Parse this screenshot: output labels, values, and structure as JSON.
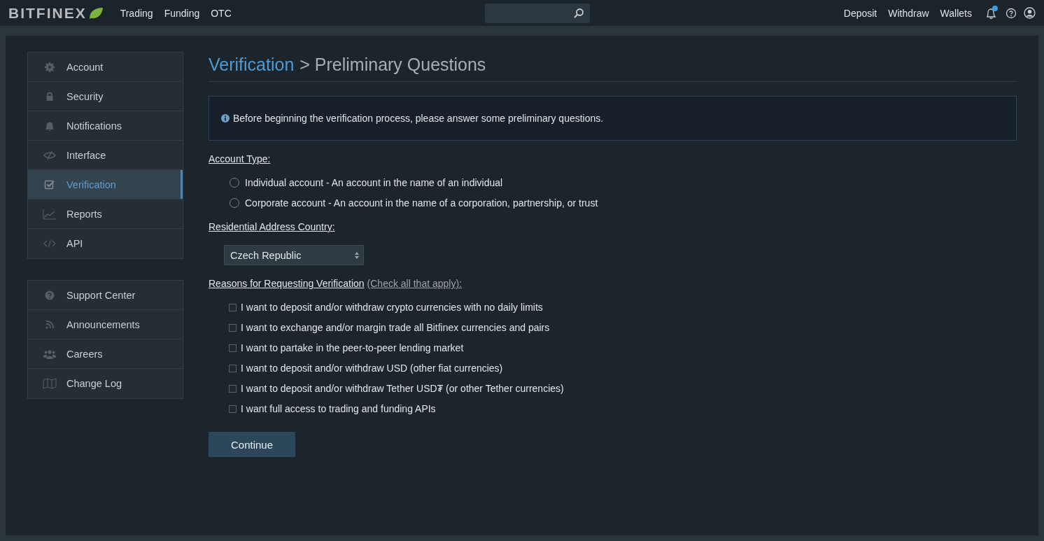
{
  "topbar": {
    "logo": "BITFINEX",
    "nav": [
      "Trading",
      "Funding",
      "OTC"
    ],
    "links": [
      "Deposit",
      "Withdraw",
      "Wallets"
    ],
    "notification_dot": true
  },
  "sidebar": {
    "groups": [
      [
        {
          "label": "Account",
          "selected": false
        },
        {
          "label": "Security",
          "selected": false
        },
        {
          "label": "Notifications",
          "selected": false
        },
        {
          "label": "Interface",
          "selected": false
        },
        {
          "label": "Verification",
          "selected": true
        },
        {
          "label": "Reports",
          "selected": false
        },
        {
          "label": "API",
          "selected": false
        }
      ],
      [
        {
          "label": "Support Center",
          "selected": false
        },
        {
          "label": "Announcements",
          "selected": false
        },
        {
          "label": "Careers",
          "selected": false
        },
        {
          "label": "Change Log",
          "selected": false
        }
      ]
    ]
  },
  "breadcrumb": {
    "link": "Verification",
    "current": "> Preliminary Questions"
  },
  "info": "Before beginning the verification process, please answer some preliminary questions.",
  "account_type": {
    "label": "Account Type:",
    "options": [
      {
        "label": "Individual account - An account in the name of an individual",
        "selected": false
      },
      {
        "label": "Corporate account - An account in the name of a corporation, partnership, or trust",
        "selected": false
      }
    ]
  },
  "country": {
    "label": "Residential Address Country:",
    "value": "Czech Republic"
  },
  "reasons": {
    "label": "Reasons for Requesting Verification",
    "note": "(Check all that apply):",
    "options": [
      {
        "label": "I want to deposit and/or withdraw crypto currencies with no daily limits",
        "checked": false
      },
      {
        "label": "I want to exchange and/or margin trade all Bitfinex currencies and pairs",
        "checked": false
      },
      {
        "label": "I want to partake in the peer-to-peer lending market",
        "checked": false
      },
      {
        "label": "I want to deposit and/or withdraw USD (other fiat currencies)",
        "checked": false
      },
      {
        "label": "I want to deposit and/or withdraw Tether USD₮ (or other Tether currencies)",
        "checked": false
      },
      {
        "label": "I want full access to trading and funding APIs",
        "checked": false
      }
    ]
  },
  "continue_button": "Continue"
}
